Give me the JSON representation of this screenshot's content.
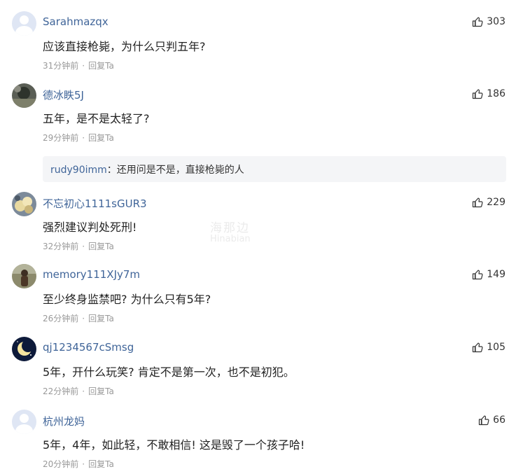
{
  "watermark": {
    "cn": "海那边",
    "en": "Hinabian"
  },
  "comments": [
    {
      "username": "Sarahmazqx",
      "text": "应该直接枪毙，为什么只判五年?",
      "time": "31分钟前",
      "reply": "回复Ta",
      "likes": "303",
      "avatar": "default"
    },
    {
      "username": "德冰眣5J",
      "text": "五年，是不是太轻了?",
      "time": "29分钟前",
      "reply": "回复Ta",
      "likes": "186",
      "avatar": "photo-dark",
      "sub_reply": {
        "username": "rudy90imm",
        "separator": "：",
        "text": "还用问是不是，直接枪毙的人"
      }
    },
    {
      "username": "不忘初心1111sGUR3",
      "text": "强烈建议判处死刑!",
      "time": "32分钟前",
      "reply": "回复Ta",
      "likes": "229",
      "avatar": "photo-flowers"
    },
    {
      "username": "memory111XJy7m",
      "text": "至少终身监禁吧? 为什么只有5年?",
      "time": "26分钟前",
      "reply": "回复Ta",
      "likes": "149",
      "avatar": "photo-person"
    },
    {
      "username": "qj1234567cSmsg",
      "text": "5年，开什么玩笑? 肯定不是第一次，也不是初犯。",
      "time": "22分钟前",
      "reply": "回复Ta",
      "likes": "105",
      "avatar": "moon"
    },
    {
      "username": "杭州龙妈",
      "text": "5年，4年，如此轻，不敢相信! 这是毁了一个孩子哈!",
      "time": "20分钟前",
      "reply": "回复Ta",
      "likes": "66",
      "avatar": "default"
    }
  ]
}
